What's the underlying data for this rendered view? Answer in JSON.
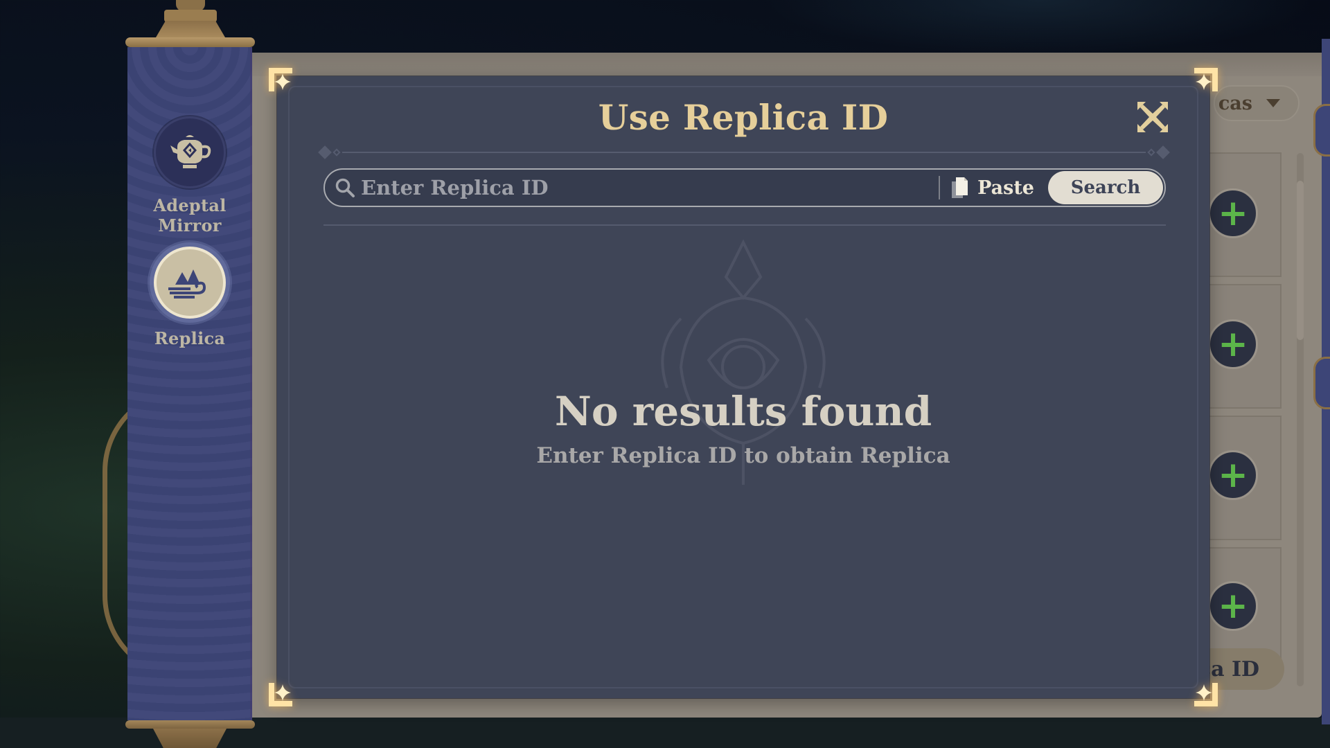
{
  "sidebar": {
    "items": [
      {
        "label": "Adeptal Mirror",
        "icon": "teapot-icon",
        "active": false
      },
      {
        "label": "Replica",
        "icon": "mountain-cloud-icon",
        "active": true
      }
    ]
  },
  "background_panel": {
    "filter_dropdown_partial_label": "cas",
    "add_slot_symbol": "+",
    "use_replica_button_partial_label": "ca ID"
  },
  "modal": {
    "title": "Use Replica ID",
    "close_icon": "close-icon",
    "search": {
      "value": "",
      "placeholder": "Enter Replica ID",
      "paste_label": "Paste",
      "search_label": "Search"
    },
    "empty_state": {
      "title": "No results found",
      "subtitle": "Enter Replica ID to obtain Replica"
    }
  },
  "colors": {
    "modal_bg": "#3f4557",
    "title_gold": "#e6cf9a",
    "sidebar_blue": "#3d4577",
    "search_button_bg": "#e2ddd2",
    "add_plus_green": "#5cb54a",
    "corner_glow": "#ffd98a"
  }
}
